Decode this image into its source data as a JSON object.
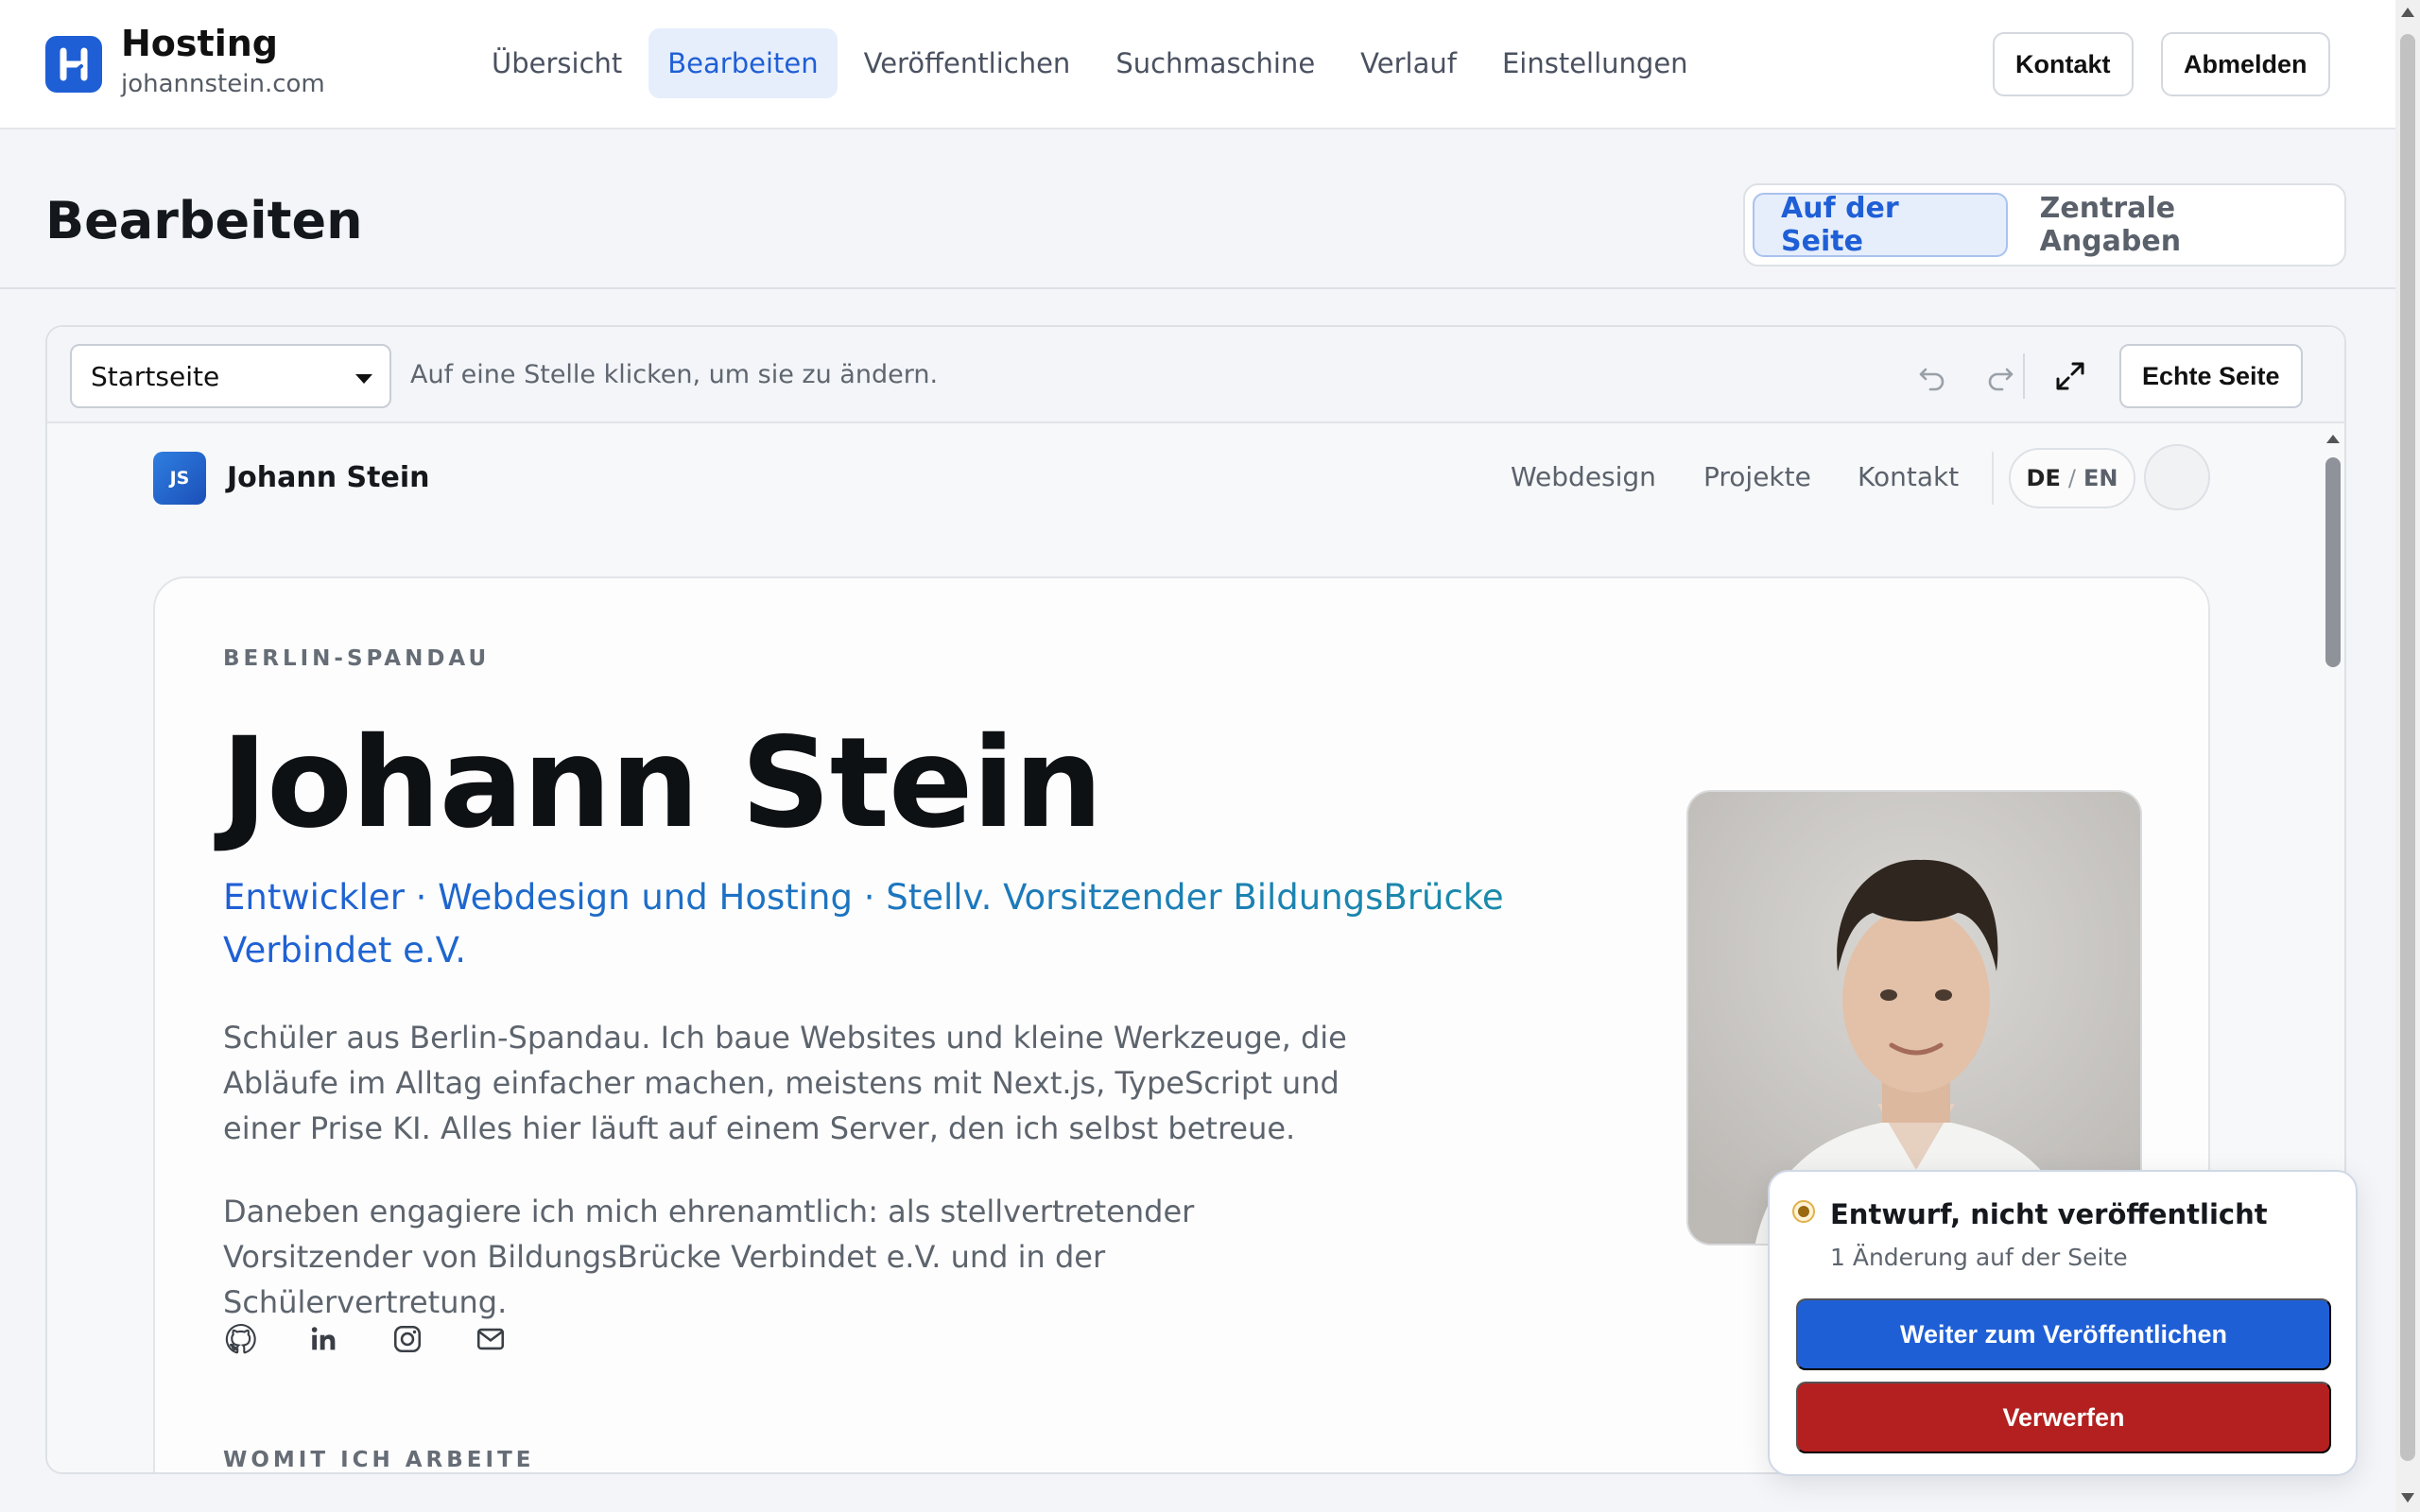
{
  "app": {
    "title": "Hosting",
    "domain": "johannstein.com",
    "logo_letter": "H"
  },
  "nav": {
    "items": [
      {
        "label": "Übersicht"
      },
      {
        "label": "Bearbeiten"
      },
      {
        "label": "Veröffentlichen"
      },
      {
        "label": "Suchmaschine"
      },
      {
        "label": "Verlauf"
      },
      {
        "label": "Einstellungen"
      }
    ],
    "active": "Bearbeiten"
  },
  "header_actions": {
    "contact": "Kontakt",
    "logout": "Abmelden"
  },
  "page": {
    "title": "Bearbeiten",
    "mode_toggle": {
      "on_page": "Auf der Seite",
      "central": "Zentrale Angaben",
      "active": "Auf der Seite"
    }
  },
  "editor": {
    "page_select": "Startseite",
    "hint": "Auf eine Stelle klicken, um sie zu ändern.",
    "icons": [
      "undo-icon",
      "redo-icon",
      "expand-icon"
    ],
    "real_page_button": "Echte Seite"
  },
  "site": {
    "logo_initials": "JS",
    "name": "Johann Stein",
    "nav": [
      "Webdesign",
      "Projekte",
      "Kontakt"
    ],
    "lang": {
      "de": "DE",
      "sep": "/",
      "en": "EN"
    },
    "hero": {
      "eyebrow": "BERLIN-SPANDAU",
      "name": "Johann Stein",
      "tagline": "Entwickler · Webdesign und Hosting · Stellv. Vorsitzender BildungsBrücke Verbindet e.V.",
      "bio_1": "Schüler aus Berlin-Spandau. Ich baue Websites und kleine Werkzeuge, die Abläufe im Alltag einfacher machen, meistens mit Next.js, TypeScript und einer Prise KI. Alles hier läuft auf einem Server, den ich selbst betreue.",
      "bio_2": "Daneben engagiere ich mich ehrenamtlich: als stellvertretender Vorsitzender von BildungsBrücke Verbindet e.V. und in der Schülervertretung.",
      "socials": [
        "github-icon",
        "linkedin-icon",
        "instagram-icon",
        "mail-icon"
      ],
      "next_section": "WOMIT ICH ARBEITE"
    }
  },
  "draft": {
    "status": "Entwurf, nicht veröffentlicht",
    "changes": "1 Änderung auf der Seite",
    "publish_button": "Weiter zum Veröffentlichen",
    "discard_button": "Verwerfen"
  },
  "colors": {
    "accent": "#1f5fd6",
    "danger": "#b3201f",
    "draft_dot": "#9a6a10"
  }
}
